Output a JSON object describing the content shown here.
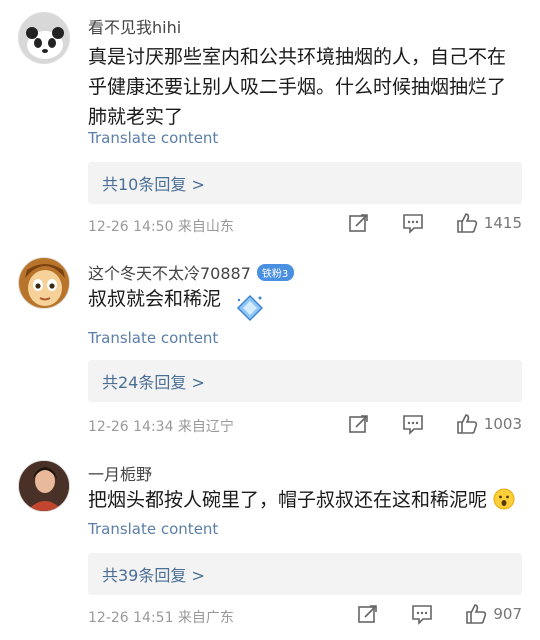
{
  "comments": [
    {
      "username": "看不见我hihi",
      "text": "真是讨厌那些室内和公共环境抽烟的人，自己不在乎健康还要让别人吸二手烟。什么时候抽烟抽烂了肺就老实了",
      "translate": "Translate content",
      "replies": "共10条回复 >",
      "time_location": "12-26 14:50 来自山东",
      "likes": "1415",
      "avatar_icon": "panda-avatar"
    },
    {
      "username": "这个冬天不太冷70887",
      "badge": "铁粉3",
      "text": "叔叔就会和稀泥",
      "translate": "Translate content",
      "replies": "共24条回复 >",
      "time_location": "12-26 14:34 来自辽宁",
      "likes": "1003",
      "avatar_icon": "cartoon-face-avatar",
      "sticker_icon": "diamond-sticker-icon"
    },
    {
      "username": "一月栀野",
      "text": "把烟头都按人碗里了，帽子叔叔还在这和稀泥呢",
      "translate": "Translate content",
      "replies": "共39条回复 >",
      "time_location": "12-26 14:51 来自广东",
      "likes": "907",
      "avatar_icon": "person-photo-avatar",
      "emoji_icon": "surprised-emoji-icon"
    }
  ],
  "colors": {
    "link_blue": "#5b7ea8",
    "reply_bg": "#f3f3f3",
    "meta_gray": "#9a9a9a",
    "badge_blue": "#4a8fe0"
  }
}
